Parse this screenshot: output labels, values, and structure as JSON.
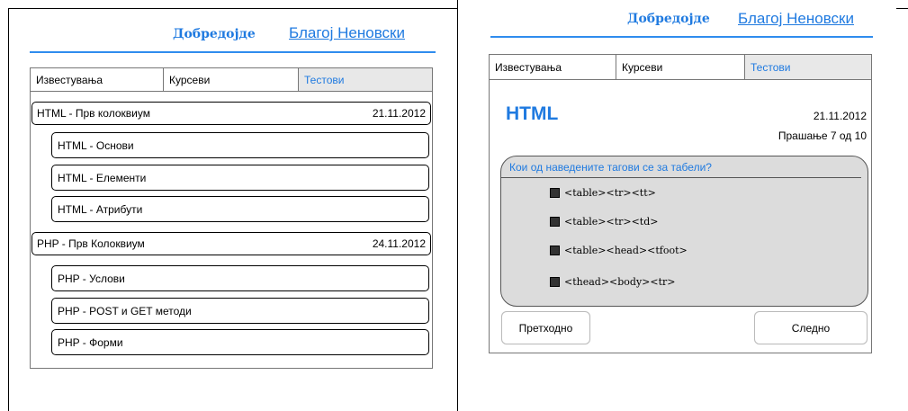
{
  "left": {
    "welcome": "Добредојде",
    "username": "Благој Неновски",
    "tabs": [
      "Известувања",
      "Курсеви",
      "Тестови"
    ],
    "groups": [
      {
        "title": "HTML - Прв колоквиум",
        "date": "21.11.2012",
        "items": [
          "HTML - Основи",
          "HTML - Елементи",
          "HTML - Атрибути"
        ]
      },
      {
        "title": "PHP - Прв Колоквиум",
        "date": "24.11.2012",
        "items": [
          "PHP - Услови",
          "PHP - POST и GET методи",
          "PHP - Форми"
        ]
      }
    ]
  },
  "right": {
    "welcome": "Добредојде",
    "username": "Благој Неновски",
    "tabs": [
      "Известувања",
      "Курсеви",
      "Тестови"
    ],
    "test_title": "HTML",
    "date": "21.11.2012",
    "progress": "Прашање 7 од 10",
    "question": "Кои од наведените тагови се за табели?",
    "options": [
      "<table><tr><tt>",
      "<table><tr><td>",
      "<table><head><tfoot>",
      "<thead><body><tr>"
    ],
    "prev_label": "Претходно",
    "next_label": "Следно"
  },
  "colors": {
    "accent": "#1f7ae0",
    "question_bg": "#dcdcdc"
  }
}
